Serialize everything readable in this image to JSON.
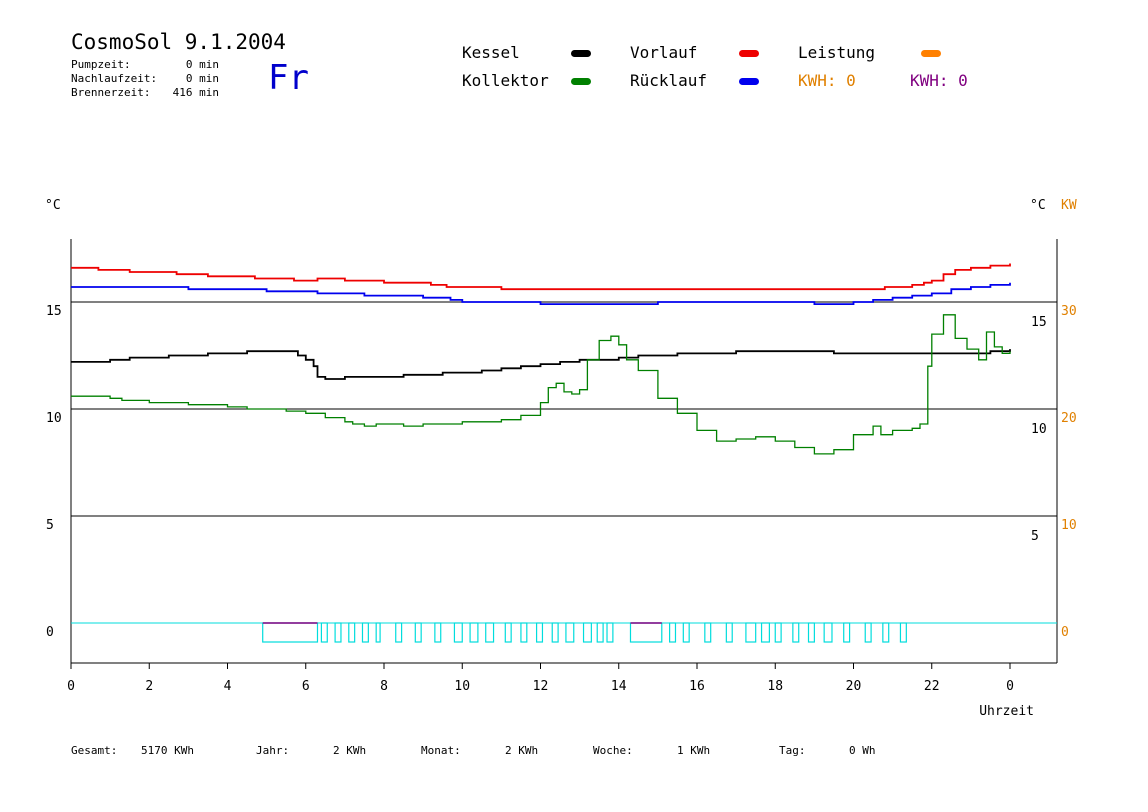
{
  "header": {
    "title": "CosmoSol 9.1.2004",
    "day": "Fr",
    "stats": [
      {
        "label": "Pumpzeit:",
        "value": "0 min"
      },
      {
        "label": "Nachlaufzeit:",
        "value": "0 min"
      },
      {
        "label": "Brennerzeit:",
        "value": "416 min"
      }
    ]
  },
  "legend": {
    "kessel": {
      "label": "Kessel",
      "color": "#000000"
    },
    "kollektor": {
      "label": "Kollektor",
      "color": "#008000"
    },
    "vorlauf": {
      "label": "Vorlauf",
      "color": "#ee0000"
    },
    "ruecklauf": {
      "label": "Rücklauf",
      "color": "#0000ee"
    },
    "leistung": {
      "label": "Leistung",
      "color": "#ff8000"
    },
    "kwh_orange": "KWH: 0",
    "kwh_purple": "KWH: 0",
    "orange": "#e08000",
    "purple": "#800080"
  },
  "footer": {
    "gesamt_label": "Gesamt:",
    "gesamt_value": "5170 KWh",
    "jahr_label": "Jahr:",
    "jahr_value": "2 KWh",
    "monat_label": "Monat:",
    "monat_value": "2 KWh",
    "woche_label": "Woche:",
    "woche_value": "1 KWh",
    "tag_label": "Tag:",
    "tag_value": "0 Wh"
  },
  "chart_data": {
    "type": "line",
    "y_left_label": "°C",
    "y_right_label_celsius": "°C",
    "y_right_label_power": "KW",
    "x_label": "Uhrzeit",
    "x_ticks": [
      "0",
      "2",
      "4",
      "6",
      "8",
      "10",
      "12",
      "14",
      "16",
      "18",
      "20",
      "22",
      "0"
    ],
    "y_left_ticks": [
      15,
      10,
      5,
      0
    ],
    "y_right_inner_ticks": [
      15,
      10,
      5
    ],
    "y_right_power_ticks": [
      30,
      20,
      10,
      0
    ],
    "xlim": [
      0,
      24
    ],
    "ylim": [
      -1.8,
      17.5
    ],
    "grid": "horizontal",
    "series": [
      {
        "name": "Vorlauf",
        "color": "#ee0000",
        "x": [
          0,
          0.7,
          1.5,
          2.7,
          3.5,
          4.7,
          5.7,
          6.3,
          7,
          8,
          9.2,
          9.6,
          11,
          12.3,
          13,
          14,
          14.8,
          16,
          17,
          18,
          19,
          20,
          20.8,
          21.5,
          21.8,
          22,
          22.3,
          22.6,
          23,
          23.5,
          24
        ],
        "y": [
          16.6,
          16.5,
          16.4,
          16.3,
          16.2,
          16.1,
          16.0,
          16.1,
          16.0,
          15.9,
          15.8,
          15.7,
          15.6,
          15.6,
          15.6,
          15.6,
          15.6,
          15.6,
          15.6,
          15.6,
          15.6,
          15.6,
          15.7,
          15.8,
          15.9,
          16.0,
          16.3,
          16.5,
          16.6,
          16.7,
          16.8
        ]
      },
      {
        "name": "Rücklauf",
        "color": "#0000ee",
        "x": [
          0,
          1,
          2,
          3,
          4,
          5,
          6,
          6.3,
          7,
          7.5,
          8.3,
          9,
          9.7,
          10,
          11,
          12,
          13,
          14,
          15,
          16,
          17,
          18,
          19,
          20,
          20.5,
          21,
          21.5,
          22,
          22.5,
          23,
          23.5,
          24
        ],
        "y": [
          15.7,
          15.7,
          15.7,
          15.6,
          15.6,
          15.5,
          15.5,
          15.4,
          15.4,
          15.3,
          15.3,
          15.2,
          15.1,
          15.0,
          15.0,
          14.9,
          14.9,
          14.9,
          15.0,
          15.0,
          15.0,
          15.0,
          14.9,
          15.0,
          15.1,
          15.2,
          15.3,
          15.4,
          15.6,
          15.7,
          15.8,
          15.9
        ]
      },
      {
        "name": "Kessel",
        "color": "#000000",
        "x": [
          0,
          0.5,
          1,
          1.5,
          2,
          2.5,
          3,
          3.5,
          4,
          4.5,
          5,
          5.5,
          5.8,
          6,
          6.2,
          6.3,
          6.5,
          7,
          7.5,
          8,
          8.5,
          9,
          9.5,
          10,
          10.5,
          11,
          11.5,
          12,
          12.5,
          13,
          13.5,
          14,
          14.5,
          15,
          15.5,
          16,
          16.5,
          17,
          17.5,
          18,
          18.5,
          19,
          19.5,
          20,
          20.5,
          21,
          21.5,
          22,
          22.5,
          23,
          23.5,
          24
        ],
        "y": [
          12.2,
          12.2,
          12.3,
          12.4,
          12.4,
          12.5,
          12.5,
          12.6,
          12.6,
          12.7,
          12.7,
          12.7,
          12.5,
          12.3,
          12.0,
          11.5,
          11.4,
          11.5,
          11.5,
          11.5,
          11.6,
          11.6,
          11.7,
          11.7,
          11.8,
          11.9,
          12.0,
          12.1,
          12.2,
          12.3,
          12.3,
          12.4,
          12.5,
          12.5,
          12.6,
          12.6,
          12.6,
          12.7,
          12.7,
          12.7,
          12.7,
          12.7,
          12.6,
          12.6,
          12.6,
          12.6,
          12.6,
          12.6,
          12.6,
          12.6,
          12.7,
          12.8
        ]
      },
      {
        "name": "Kollektor",
        "color": "#008000",
        "x": [
          0,
          0.5,
          1,
          1.3,
          1.5,
          2,
          2.5,
          3,
          3.5,
          4,
          4.5,
          5,
          5.5,
          6,
          6.5,
          7,
          7.2,
          7.5,
          7.8,
          8,
          8.5,
          9,
          9.5,
          10,
          10.5,
          11,
          11.5,
          12,
          12.2,
          12.4,
          12.6,
          12.8,
          13,
          13.2,
          13.5,
          13.8,
          14,
          14.2,
          14.5,
          15,
          15.5,
          16,
          16.5,
          17,
          17.5,
          18,
          18.5,
          19,
          19.5,
          20,
          20.5,
          20.7,
          21,
          21.5,
          21.7,
          21.9,
          22,
          22.3,
          22.6,
          22.9,
          23.2,
          23.4,
          23.6,
          23.8,
          24
        ],
        "y": [
          10.6,
          10.6,
          10.5,
          10.4,
          10.4,
          10.3,
          10.3,
          10.2,
          10.2,
          10.1,
          10.0,
          10.0,
          9.9,
          9.8,
          9.6,
          9.4,
          9.3,
          9.2,
          9.3,
          9.3,
          9.2,
          9.3,
          9.3,
          9.4,
          9.4,
          9.5,
          9.7,
          10.3,
          11.0,
          11.2,
          10.8,
          10.7,
          10.9,
          12.3,
          13.2,
          13.4,
          13.0,
          12.3,
          11.8,
          10.5,
          9.8,
          9.0,
          8.5,
          8.6,
          8.7,
          8.5,
          8.2,
          7.9,
          8.1,
          8.8,
          9.2,
          8.8,
          9.0,
          9.1,
          9.3,
          12.0,
          13.5,
          14.4,
          13.3,
          12.8,
          12.3,
          13.6,
          12.9,
          12.6,
          12.7
        ]
      }
    ],
    "pump_blocks": [
      [
        4.9,
        6.3
      ],
      [
        6.4,
        6.55
      ],
      [
        6.75,
        6.9
      ],
      [
        7.1,
        7.25
      ],
      [
        7.45,
        7.6
      ],
      [
        7.8,
        7.9
      ],
      [
        8.3,
        8.45
      ],
      [
        8.8,
        8.95
      ],
      [
        9.3,
        9.45
      ],
      [
        9.8,
        10.0
      ],
      [
        10.2,
        10.4
      ],
      [
        10.6,
        10.8
      ],
      [
        11.1,
        11.25
      ],
      [
        11.5,
        11.65
      ],
      [
        11.9,
        12.05
      ],
      [
        12.3,
        12.45
      ],
      [
        12.65,
        12.85
      ],
      [
        13.1,
        13.3
      ],
      [
        13.45,
        13.6
      ],
      [
        13.7,
        13.85
      ],
      [
        14.3,
        15.1
      ],
      [
        15.3,
        15.45
      ],
      [
        15.65,
        15.8
      ],
      [
        16.2,
        16.35
      ],
      [
        16.75,
        16.9
      ],
      [
        17.25,
        17.5
      ],
      [
        17.65,
        17.85
      ],
      [
        18.0,
        18.15
      ],
      [
        18.45,
        18.6
      ],
      [
        18.85,
        19.0
      ],
      [
        19.25,
        19.45
      ],
      [
        19.75,
        19.9
      ],
      [
        20.3,
        20.45
      ],
      [
        20.75,
        20.9
      ],
      [
        21.2,
        21.35
      ]
    ],
    "burner_marks": [
      [
        4.9,
        6.3
      ],
      [
        14.3,
        15.1
      ]
    ]
  }
}
